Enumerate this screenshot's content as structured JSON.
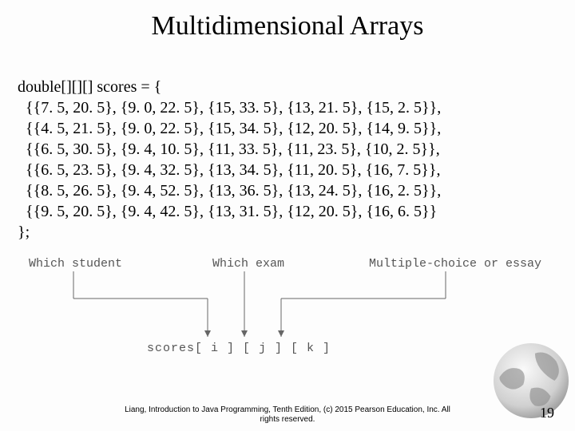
{
  "title": "Multidimensional Arrays",
  "code": {
    "decl": "double[][][] scores = {",
    "rows": [
      "  {{7. 5, 20. 5}, {9. 0, 22. 5}, {15, 33. 5}, {13, 21. 5}, {15, 2. 5}},",
      "  {{4. 5, 21. 5}, {9. 0, 22. 5}, {15, 34. 5}, {12, 20. 5}, {14, 9. 5}},",
      "  {{6. 5, 30. 5}, {9. 4, 10. 5}, {11, 33. 5}, {11, 23. 5}, {10, 2. 5}},",
      "  {{6. 5, 23. 5}, {9. 4, 32. 5}, {13, 34. 5}, {11, 20. 5}, {16, 7. 5}},",
      "  {{8. 5, 26. 5}, {9. 4, 52. 5}, {13, 36. 5}, {13, 24. 5}, {16, 2. 5}},",
      "  {{9. 5, 20. 5}, {9. 4, 42. 5}, {13, 31. 5}, {12, 20. 5}, {16, 6. 5}}"
    ],
    "end": "};"
  },
  "diagram": {
    "label_student": "Which student",
    "label_exam": "Which exam",
    "label_mc": "Multiple-choice or essay",
    "expr": "scores[ i ] [ j ] [ k ]"
  },
  "footer": {
    "line1": "Liang, Introduction to Java Programming, Tenth Edition, (c) 2015 Pearson Education, Inc. All",
    "line2": "rights reserved."
  },
  "pagenum": "19"
}
